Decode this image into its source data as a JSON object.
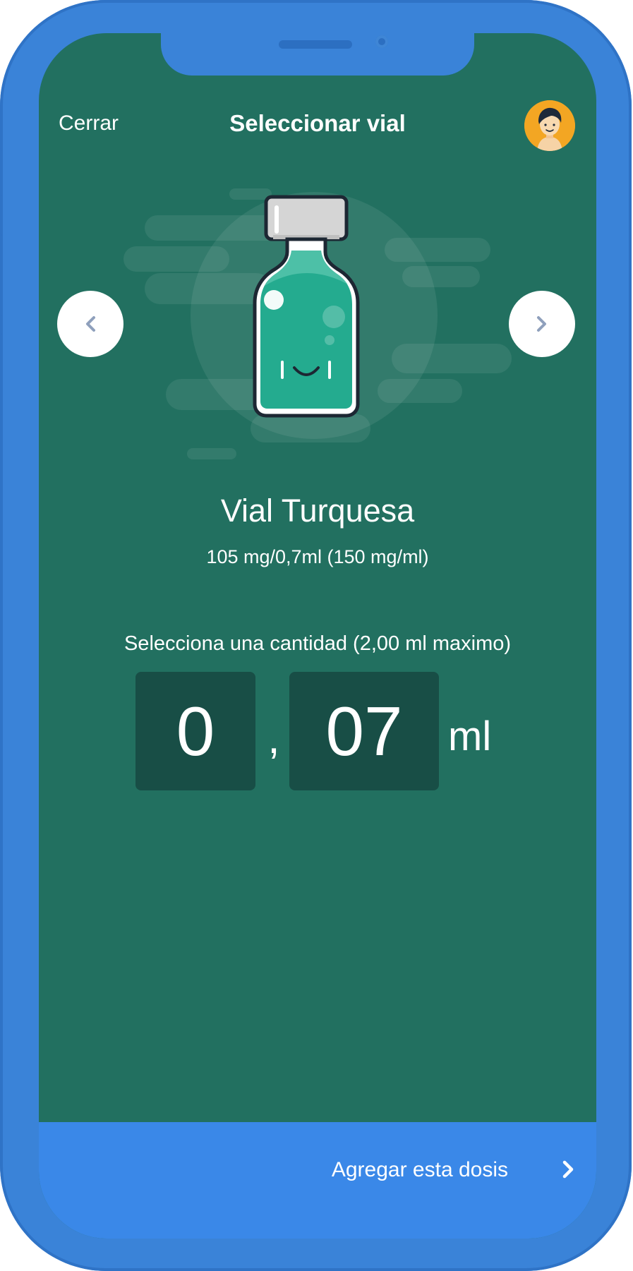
{
  "header": {
    "close_label": "Cerrar",
    "title": "Seleccionar vial"
  },
  "vial": {
    "name": "Vial Turquesa",
    "concentration": "105 mg/0,7ml (150 mg/ml)"
  },
  "amount": {
    "label": "Selecciona una cantidad (2,00 ml maximo)",
    "integer_part": "0",
    "separator": ",",
    "decimal_part": "07",
    "unit": "ml"
  },
  "footer": {
    "action_label": "Agregar esta dosis"
  },
  "icons": {
    "prev": "chevron-left-icon",
    "next": "chevron-right-icon",
    "avatar": "user-avatar-icon",
    "footer_chevron": "chevron-right-icon"
  },
  "colors": {
    "device": "#3a83d8",
    "screen_bg": "#227060",
    "digit_box": "#184e46",
    "footer_bar": "#3a88e8",
    "vial_liquid": "#24ab8f"
  }
}
